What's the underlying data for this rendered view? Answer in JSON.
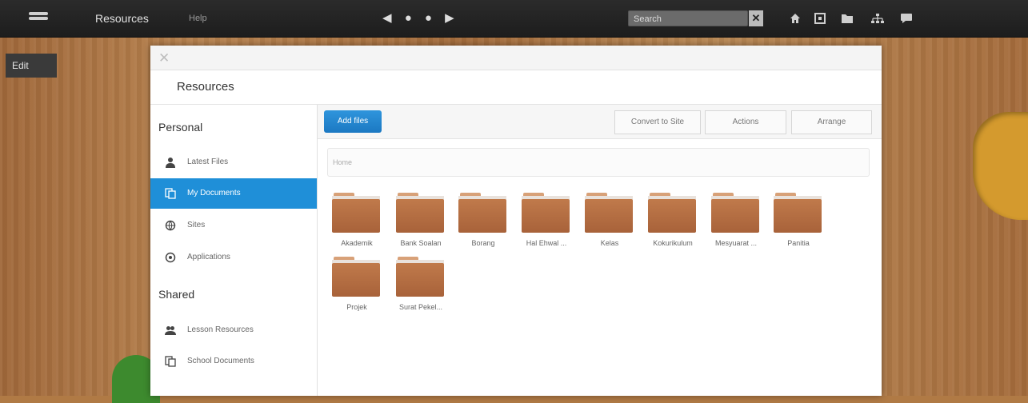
{
  "topbar": {
    "title": "Resources",
    "help": "Help",
    "pager": "◀ ● ● ▶",
    "search_placeholder": "Search",
    "search_clear": "✕",
    "icons": [
      "home-icon",
      "frame-icon",
      "folder-icon",
      "network-icon",
      "chat-icon"
    ]
  },
  "edit_tab": "Edit",
  "modal": {
    "close": "✕",
    "title": "Resources"
  },
  "sidebar": {
    "personal_heading": "Personal",
    "shared_heading": "Shared",
    "items": [
      {
        "label": "Latest Files",
        "icon": "person-icon"
      },
      {
        "label": "My Documents",
        "icon": "documents-icon"
      },
      {
        "label": "Sites",
        "icon": "globe-icon"
      },
      {
        "label": "Applications",
        "icon": "applications-icon"
      }
    ],
    "shared_items": [
      {
        "label": "Lesson Resources",
        "icon": "people-icon"
      },
      {
        "label": "School Documents",
        "icon": "documents-icon"
      }
    ]
  },
  "toolbar": {
    "add_files": "Add files",
    "convert": "Convert to Site",
    "actions": "Actions",
    "arrange": "Arrange"
  },
  "breadcrumb": "Home",
  "folders": [
    "Akademik",
    "Bank Soalan",
    "Borang",
    "Hal Ehwal ...",
    "Kelas",
    "Kokurikulum",
    "Mesyuarat ...",
    "Panitia",
    "Projek",
    "Surat Pekel..."
  ]
}
